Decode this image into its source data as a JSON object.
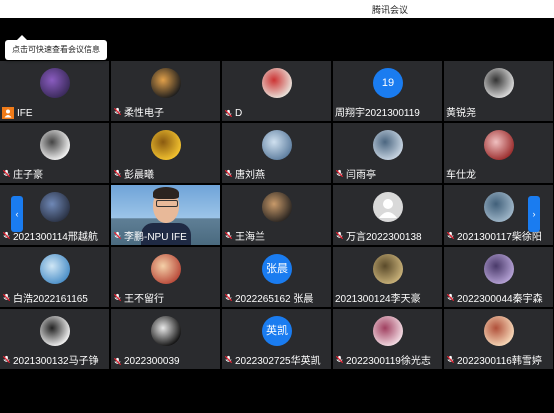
{
  "window": {
    "title": "腾讯会议"
  },
  "tip": {
    "text": "点击可快速查看会议信息"
  },
  "nav": {
    "prev_icon": "chevron-left-icon",
    "next_icon": "chevron-right-icon",
    "prev_glyph": "‹",
    "next_glyph": "›"
  },
  "colors": {
    "background": "#000000",
    "tile": "#2a2b2e",
    "accent": "#1a7cf0",
    "host_badge": "#f07b19"
  },
  "participants": [
    {
      "name": "IFE",
      "avatar": "image",
      "host": true,
      "mic": false
    },
    {
      "name": "柔性电子",
      "avatar": "image",
      "mic": true
    },
    {
      "name": "D",
      "avatar": "image",
      "mic": true
    },
    {
      "name": "周翔宇2021300119",
      "avatar": "text",
      "avatar_text": "19",
      "mic": false
    },
    {
      "name": "黄锐尧",
      "avatar": "image",
      "mic": false
    },
    {
      "name": "庄子豪",
      "avatar": "image",
      "mic": true
    },
    {
      "name": "彭晨曦",
      "avatar": "image",
      "mic": true
    },
    {
      "name": "唐刘燕",
      "avatar": "image",
      "mic": true
    },
    {
      "name": "闫雨亭",
      "avatar": "image",
      "mic": true
    },
    {
      "name": "车仕龙",
      "avatar": "image",
      "mic": false
    },
    {
      "name": "2021300114邢越航",
      "avatar": "image",
      "mic": true
    },
    {
      "name": "李鹏-NPU IFE",
      "avatar": "video",
      "mic": true
    },
    {
      "name": "王海兰",
      "avatar": "image",
      "mic": true
    },
    {
      "name": "万言2022300138",
      "avatar": "default",
      "mic": true
    },
    {
      "name": "2021300117柴徐阳",
      "avatar": "image",
      "mic": true
    },
    {
      "name": "白浩2022161165",
      "avatar": "image",
      "mic": true
    },
    {
      "name": "王不留行",
      "avatar": "image",
      "mic": true
    },
    {
      "name": "2022265162 张晨",
      "avatar": "text",
      "avatar_text": "张晨",
      "mic": true
    },
    {
      "name": "2021300124李天豪",
      "avatar": "image",
      "mic": false
    },
    {
      "name": "2022300044秦宇森",
      "avatar": "image",
      "mic": true
    },
    {
      "name": "2021300132马子铮",
      "avatar": "image",
      "mic": true
    },
    {
      "name": "2022300039",
      "avatar": "image",
      "mic": true
    },
    {
      "name": "2022302725华英凯",
      "avatar": "text",
      "avatar_text": "英凯",
      "mic": true
    },
    {
      "name": "2022300119徐光志",
      "avatar": "image",
      "mic": true
    },
    {
      "name": "2022300116韩雪婷",
      "avatar": "image",
      "mic": true
    }
  ]
}
